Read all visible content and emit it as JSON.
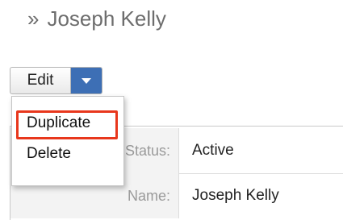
{
  "header": {
    "breadcrumb_chevron": "»",
    "record_title": "Joseph Kelly"
  },
  "actions": {
    "edit_label": "Edit",
    "dropdown_icon": "caret-down-icon",
    "menu": {
      "items": [
        {
          "label": "Duplicate",
          "highlighted": true
        },
        {
          "label": "Delete",
          "highlighted": false
        }
      ]
    }
  },
  "detail": {
    "fields": [
      {
        "label": "Status:",
        "value": "Active"
      },
      {
        "label": "Name:",
        "value": "Joseph Kelly"
      }
    ]
  },
  "colors": {
    "accent": "#3d6fb5",
    "highlight_border": "#e8371c"
  }
}
